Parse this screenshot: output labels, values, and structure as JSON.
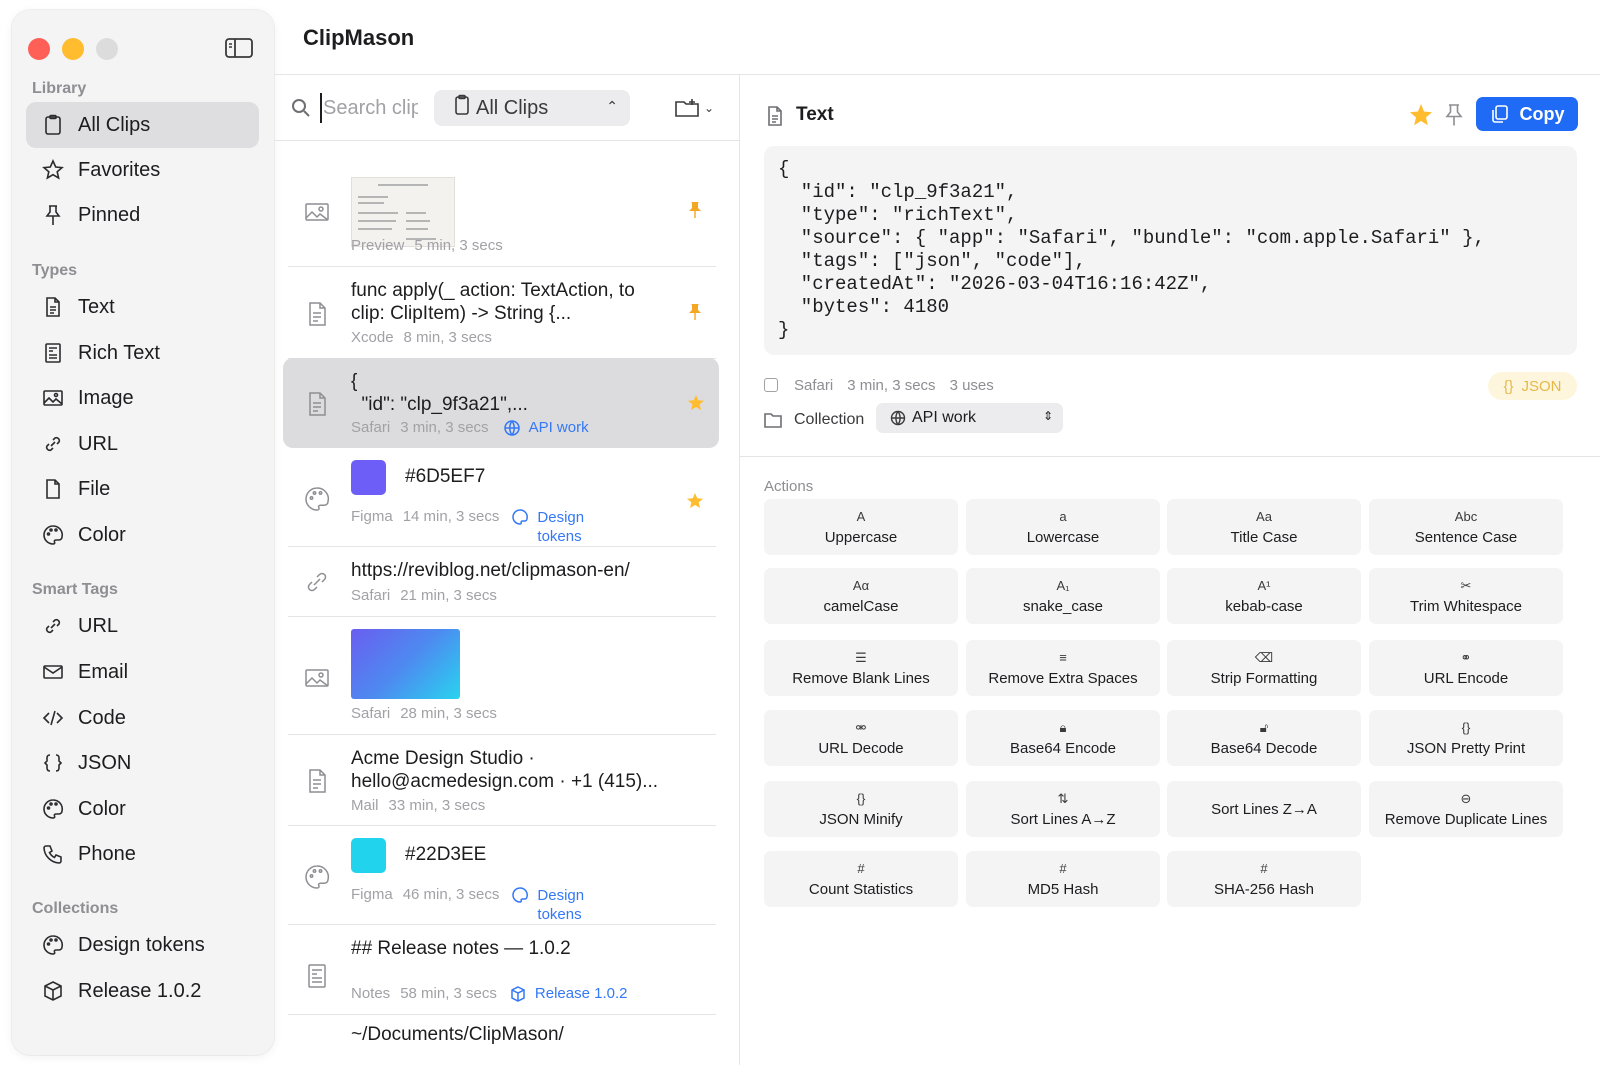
{
  "app": {
    "title": "ClipMason"
  },
  "sidebar": {
    "sections": [
      {
        "title": "Library",
        "items": [
          {
            "label": "All Clips",
            "icon": "clipboard-icon",
            "active": true
          },
          {
            "label": "Favorites",
            "icon": "star-icon"
          },
          {
            "label": "Pinned",
            "icon": "pin-icon"
          }
        ]
      },
      {
        "title": "Types",
        "items": [
          {
            "label": "Text",
            "icon": "document-icon"
          },
          {
            "label": "Rich Text",
            "icon": "rich-text-icon"
          },
          {
            "label": "Image",
            "icon": "image-icon"
          },
          {
            "label": "URL",
            "icon": "link-icon"
          },
          {
            "label": "File",
            "icon": "file-icon"
          },
          {
            "label": "Color",
            "icon": "palette-icon"
          }
        ]
      },
      {
        "title": "Smart Tags",
        "items": [
          {
            "label": "URL",
            "icon": "link-icon"
          },
          {
            "label": "Email",
            "icon": "envelope-icon"
          },
          {
            "label": "Code",
            "icon": "code-icon"
          },
          {
            "label": "JSON",
            "icon": "braces-icon"
          },
          {
            "label": "Color",
            "icon": "palette-icon"
          },
          {
            "label": "Phone",
            "icon": "phone-icon"
          }
        ]
      },
      {
        "title": "Collections",
        "items": [
          {
            "label": "Design tokens",
            "icon": "palette-icon"
          },
          {
            "label": "Release 1.0.2",
            "icon": "cube-icon"
          }
        ]
      }
    ]
  },
  "search": {
    "placeholder": "Search clips"
  },
  "filter": {
    "selected": "All Clips"
  },
  "clips": [
    {
      "type": "image",
      "thumb": "invoice",
      "source": "Preview",
      "age": "5 min, 3 secs",
      "pinned": true
    },
    {
      "type": "text",
      "text": [
        "func apply(_ action: TextAction, to",
        "clip: ClipItem) -> String {..."
      ],
      "source": "Xcode",
      "age": "8 min, 3 secs",
      "pinned": true
    },
    {
      "type": "text",
      "text": [
        "{",
        "  \"id\": \"clp_9f3a21\",..."
      ],
      "source": "Safari",
      "age": "3 min, 3 secs",
      "tag": "API work",
      "favorite": true,
      "selected": true
    },
    {
      "type": "color",
      "swatch": "#6D5EF7",
      "label": "#6D5EF7",
      "source": "Figma",
      "age": "14 min, 3 secs",
      "tag": [
        "Design",
        "tokens"
      ],
      "favorite": true
    },
    {
      "type": "url",
      "text": [
        "https://reviblog.net/clipmason-en/"
      ],
      "source": "Safari",
      "age": "21 min, 3 secs"
    },
    {
      "type": "image",
      "thumb": "gradient",
      "source": "Safari",
      "age": "28 min, 3 secs"
    },
    {
      "type": "text",
      "text": [
        "Acme Design Studio ·",
        "hello@acmedesign.com · +1 (415)..."
      ],
      "source": "Mail",
      "age": "33 min, 3 secs"
    },
    {
      "type": "color",
      "swatch": "#22D3EE",
      "label": "#22D3EE",
      "source": "Figma",
      "age": "46 min, 3 secs",
      "tag": [
        "Design",
        "tokens"
      ]
    },
    {
      "type": "richtext",
      "text": [
        "## Release notes — 1.0.2"
      ],
      "source": "Notes",
      "age": "58 min, 3 secs",
      "tag": "Release 1.0.2"
    },
    {
      "type": "file",
      "text": [
        "~/Documents/ClipMason/"
      ]
    }
  ],
  "detail": {
    "title": "Text",
    "copy_label": "Copy",
    "content": "{\n  \"id\": \"clp_9f3a21\",\n  \"type\": \"richText\",\n  \"source\": { \"app\": \"Safari\", \"bundle\": \"com.apple.Safari\" },\n  \"tags\": [\"json\", \"code\"],\n  \"createdAt\": \"2026-03-04T16:16:42Z\",\n  \"bytes\": 4180\n}",
    "source": "Safari",
    "age": "3 min, 3 secs",
    "uses": "3 uses",
    "badge": {
      "symbol": "{}",
      "label": "JSON"
    },
    "collection_label": "Collection",
    "collection_value": "API work",
    "actions_title": "Actions",
    "actions": [
      {
        "sym": "A",
        "label": "Uppercase"
      },
      {
        "sym": "a",
        "label": "Lowercase"
      },
      {
        "sym": "Aa",
        "label": "Title Case"
      },
      {
        "sym": "Abc",
        "label": "Sentence Case"
      },
      {
        "sym": "Aα",
        "label": "camelCase"
      },
      {
        "sym": "A₁",
        "label": "snake_case"
      },
      {
        "sym": "A¹",
        "label": "kebab-case"
      },
      {
        "sym": "✂",
        "label": "Trim Whitespace"
      },
      {
        "sym": "☰",
        "label": "Remove Blank Lines"
      },
      {
        "sym": "≡",
        "label": "Remove Extra Spaces"
      },
      {
        "sym": "⌫",
        "label": "Strip Formatting"
      },
      {
        "sym": "⚭",
        "label": "URL Encode"
      },
      {
        "sym": "⚮",
        "label": "URL Decode"
      },
      {
        "sym": "🔒︎",
        "label": "Base64 Encode"
      },
      {
        "sym": "🔓︎",
        "label": "Base64 Decode"
      },
      {
        "sym": "{}",
        "label": "JSON Pretty Print"
      },
      {
        "sym": "{}",
        "label": "JSON Minify"
      },
      {
        "sym": "⇅",
        "label": "Sort Lines A→Z"
      },
      {
        "sym": "",
        "label": "Sort Lines Z→A"
      },
      {
        "sym": "⊖",
        "label": "Remove Duplicate Lines"
      },
      {
        "sym": "#",
        "label": "Count Statistics"
      },
      {
        "sym": "#",
        "label": "MD5 Hash"
      },
      {
        "sym": "#",
        "label": "SHA-256 Hash"
      }
    ]
  },
  "colors": {
    "accent": "#1f6bf5",
    "star": "#febc2e",
    "pin": "#f5a623",
    "tag": "#3478f6"
  }
}
